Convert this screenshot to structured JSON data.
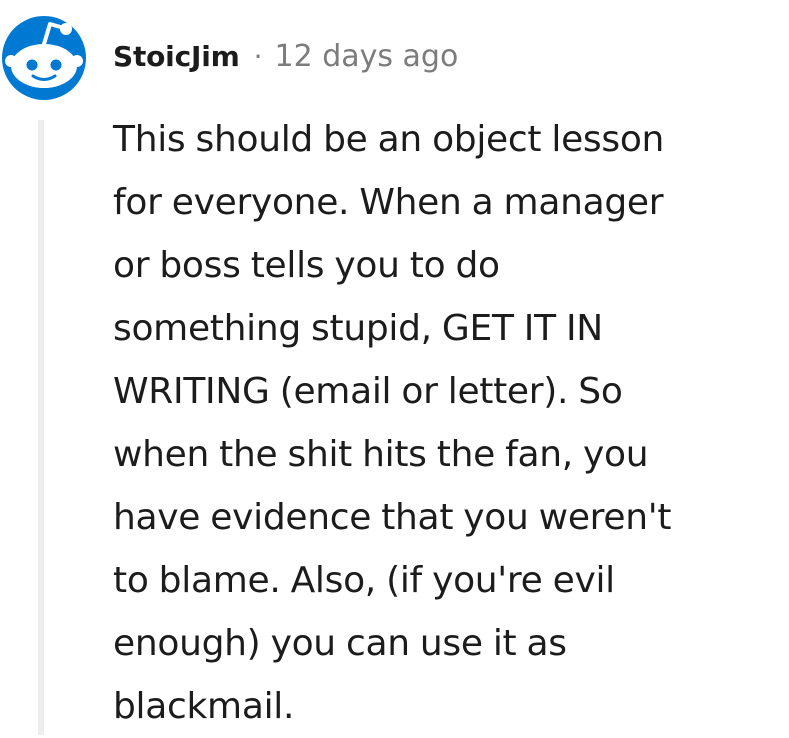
{
  "comment": {
    "author": "StoicJim",
    "separator": "·",
    "timestamp": "12 days ago",
    "avatar_icon": "reddit-snoo-icon",
    "body_lines": [
      "This should be an object lesson",
      "for everyone. When a manager",
      "or boss tells you to do",
      "something stupid, GET IT IN",
      "WRITING (email or letter). So",
      "when the shit hits the fan, you",
      "have evidence that you weren't",
      "to blame. Also, (if you're evil",
      "enough) you can use it as",
      "blackmail."
    ]
  },
  "colors": {
    "avatar_blue": "#0079D3",
    "avatar_face": "#FFFFFF",
    "text": "#1C1C1C",
    "meta": "#7C7C7C",
    "thread_line": "#EDEDED"
  }
}
